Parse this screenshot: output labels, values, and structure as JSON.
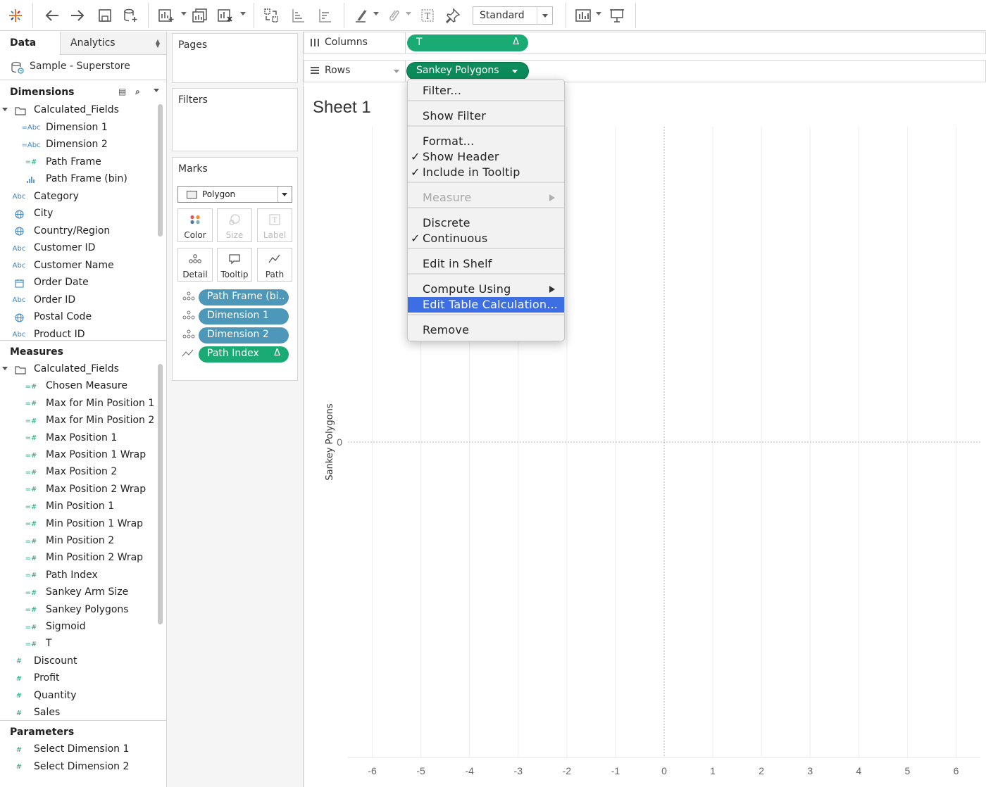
{
  "toolbar": {
    "view_mode": "Standard",
    "icons": [
      "tableau-logo-icon",
      "undo-icon",
      "redo-icon",
      "save-icon",
      "new-datasource-icon",
      "new-worksheet-icon",
      "duplicate-sheet-icon",
      "clear-sheet-icon",
      "swap-icon",
      "sort-ascending-icon",
      "sort-descending-icon",
      "highlight-icon",
      "group-icon",
      "show-labels-icon",
      "pin-icon",
      "show-me-icon",
      "presentation-icon"
    ]
  },
  "data_pane": {
    "tab_data": "Data",
    "tab_analytics": "Analytics",
    "datasource": "Sample - Superstore",
    "dimensions_header": "Dimensions",
    "dimensions": [
      {
        "label": "Calculated_Fields",
        "type": "folder"
      },
      {
        "label": "Dimension 1",
        "type": "calc-abc"
      },
      {
        "label": "Dimension 2",
        "type": "calc-abc"
      },
      {
        "label": "Path Frame",
        "type": "calc-hash"
      },
      {
        "label": "Path Frame (bin)",
        "type": "bin"
      },
      {
        "label": "Category",
        "type": "abc"
      },
      {
        "label": "City",
        "type": "geo"
      },
      {
        "label": "Country/Region",
        "type": "geo"
      },
      {
        "label": "Customer ID",
        "type": "abc"
      },
      {
        "label": "Customer Name",
        "type": "abc"
      },
      {
        "label": "Order Date",
        "type": "date"
      },
      {
        "label": "Order ID",
        "type": "abc"
      },
      {
        "label": "Postal Code",
        "type": "geo"
      },
      {
        "label": "Product ID",
        "type": "abc"
      }
    ],
    "measures_header": "Measures",
    "measures": [
      {
        "label": "Calculated_Fields",
        "type": "folder"
      },
      {
        "label": "Chosen Measure",
        "type": "calc-hash"
      },
      {
        "label": "Max for Min Position 1",
        "type": "calc-hash"
      },
      {
        "label": "Max for Min Position 2",
        "type": "calc-hash"
      },
      {
        "label": "Max Position 1",
        "type": "calc-hash"
      },
      {
        "label": "Max Position 1 Wrap",
        "type": "calc-hash"
      },
      {
        "label": "Max Position 2",
        "type": "calc-hash"
      },
      {
        "label": "Max Position 2 Wrap",
        "type": "calc-hash"
      },
      {
        "label": "Min Position 1",
        "type": "calc-hash"
      },
      {
        "label": "Min Position 1 Wrap",
        "type": "calc-hash"
      },
      {
        "label": "Min Position 2",
        "type": "calc-hash"
      },
      {
        "label": "Min Position 2 Wrap",
        "type": "calc-hash"
      },
      {
        "label": "Path Index",
        "type": "calc-hash"
      },
      {
        "label": "Sankey Arm Size",
        "type": "calc-hash"
      },
      {
        "label": "Sankey Polygons",
        "type": "calc-hash"
      },
      {
        "label": "Sigmoid",
        "type": "calc-hash"
      },
      {
        "label": "T",
        "type": "calc-hash"
      },
      {
        "label": "Discount",
        "type": "hash"
      },
      {
        "label": "Profit",
        "type": "hash"
      },
      {
        "label": "Quantity",
        "type": "hash"
      },
      {
        "label": "Sales",
        "type": "hash"
      }
    ],
    "parameters_header": "Parameters",
    "parameters": [
      {
        "label": "Select Dimension 1",
        "type": "hash"
      },
      {
        "label": "Select Dimension 2",
        "type": "hash"
      }
    ]
  },
  "cards": {
    "pages": "Pages",
    "filters": "Filters",
    "marks": "Marks",
    "mark_type": "Polygon",
    "mark_buttons": [
      {
        "label": "Color",
        "enabled": true
      },
      {
        "label": "Size",
        "enabled": false
      },
      {
        "label": "Label",
        "enabled": false
      },
      {
        "label": "Detail",
        "enabled": true
      },
      {
        "label": "Tooltip",
        "enabled": true
      },
      {
        "label": "Path",
        "enabled": true
      }
    ],
    "mark_pills": [
      {
        "label": "Path Frame (bi..",
        "color": "blue",
        "icon": "detail-icon"
      },
      {
        "label": "Dimension 1",
        "color": "blue",
        "icon": "detail-icon"
      },
      {
        "label": "Dimension 2",
        "color": "blue",
        "icon": "detail-icon"
      },
      {
        "label": "Path Index",
        "color": "green",
        "icon": "path-icon",
        "delta": "Δ"
      }
    ]
  },
  "shelves": {
    "columns_label": "Columns",
    "columns_pill": "T",
    "columns_delta": "Δ",
    "rows_label": "Rows",
    "rows_pill": "Sankey Polygons"
  },
  "sheet": {
    "title": "Sheet 1",
    "y_axis_title": "Sankey Polygons",
    "y_tick": "0"
  },
  "context_menu": [
    {
      "label": "Filter...",
      "check": false
    },
    {
      "sep": true
    },
    {
      "label": "Show Filter",
      "check": false
    },
    {
      "sep": true
    },
    {
      "label": "Format...",
      "check": false
    },
    {
      "label": "Show Header",
      "check": true
    },
    {
      "label": "Include in Tooltip",
      "check": true
    },
    {
      "sep": true
    },
    {
      "label": "Measure",
      "check": false,
      "disabled": true,
      "submenu": true
    },
    {
      "sep": true
    },
    {
      "label": "Discrete",
      "check": false
    },
    {
      "label": "Continuous",
      "check": true
    },
    {
      "sep": true
    },
    {
      "label": "Edit in Shelf",
      "check": false
    },
    {
      "sep": true
    },
    {
      "label": "Compute Using",
      "check": false,
      "submenu": true
    },
    {
      "label": "Edit Table Calculation...",
      "check": false,
      "highlight": true
    },
    {
      "sep": true
    },
    {
      "label": "Remove",
      "check": false
    }
  ],
  "chart_data": {
    "type": "scatter",
    "x": [],
    "y": [],
    "xlabel": "",
    "ylabel": "Sankey Polygons",
    "xlim": [
      -6.5,
      6.5
    ],
    "x_ticks": [
      -6,
      -5,
      -4,
      -3,
      -2,
      -1,
      0,
      1,
      2,
      3,
      4,
      5,
      6
    ],
    "y_ticks": [
      0
    ],
    "grid": true,
    "zero_lines": true
  },
  "colors": {
    "accent_green": "#1aaa73",
    "pill_blue": "#4d97b8",
    "menu_highlight": "#3d6ee3"
  }
}
